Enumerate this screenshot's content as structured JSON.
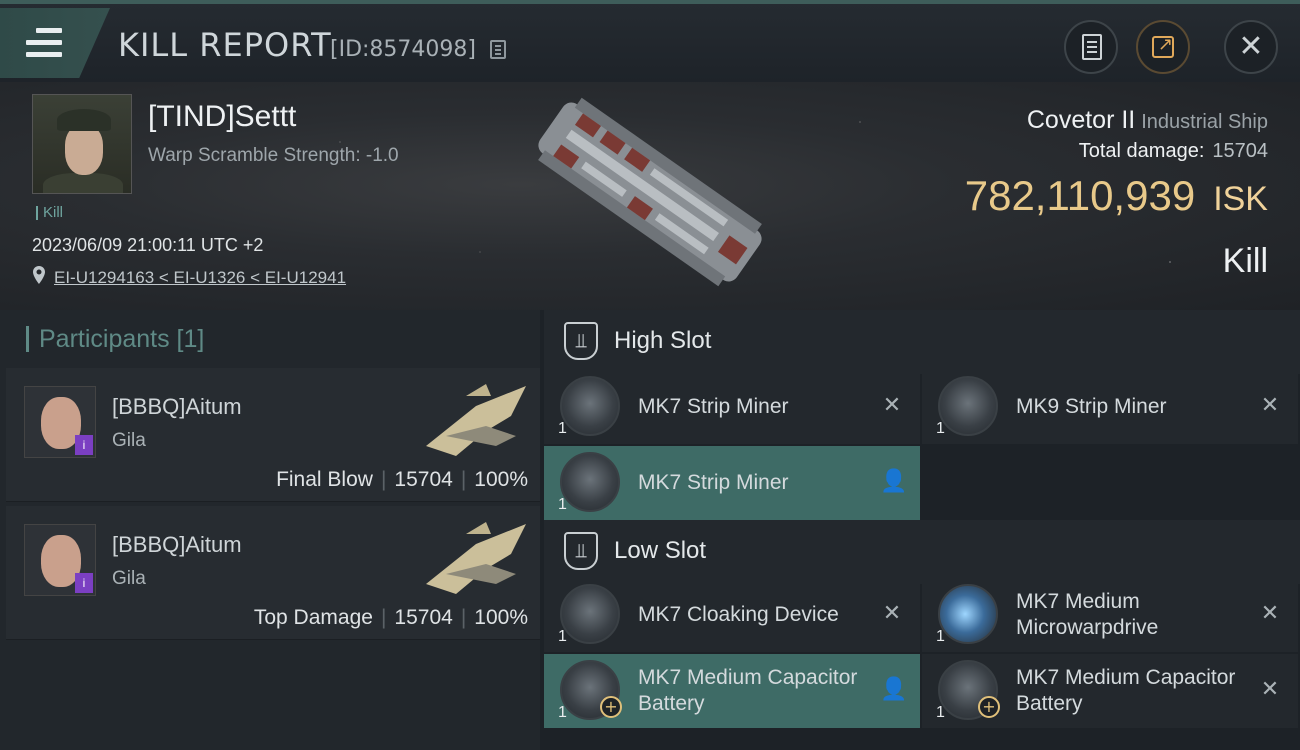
{
  "header": {
    "title": "KILL REPORT",
    "report_id": "[ID:8574098]"
  },
  "victim": {
    "name": "[TIND]Settt",
    "warp_scramble": "Warp Scramble Strength: -1.0",
    "tag": "Kill",
    "datetime": "2023/06/09 21:00:11 UTC +2",
    "location": "EI-U1294163 < EI-U1326 < EI-U12941"
  },
  "ship": {
    "name": "Covetor II",
    "class": "Industrial Ship",
    "total_damage_label": "Total damage:",
    "total_damage": "15704",
    "isk_value": "782,110,939",
    "isk_unit": "ISK",
    "result": "Kill"
  },
  "participants": {
    "title": "Participants [1]",
    "items": [
      {
        "name": "[BBBQ]Aitum",
        "ship": "Gila",
        "role": "Final Blow",
        "damage": "15704",
        "percent": "100%",
        "badge": "i"
      },
      {
        "name": "[BBBQ]Aitum",
        "ship": "Gila",
        "role": "Top Damage",
        "damage": "15704",
        "percent": "100%",
        "badge": "i"
      }
    ],
    "separator": "|"
  },
  "slots": {
    "high": {
      "title": "High Slot",
      "modules": [
        {
          "name": "MK7 Strip Miner",
          "qty": "1",
          "icon": "strip-miner-icon",
          "action": "✕"
        },
        {
          "name": "MK9 Strip Miner",
          "qty": "1",
          "icon": "strip-miner-icon",
          "action": "✕"
        },
        {
          "name": "MK7 Strip Miner",
          "qty": "1",
          "icon": "strip-miner-icon",
          "action": "👤"
        }
      ]
    },
    "low": {
      "title": "Low Slot",
      "modules": [
        {
          "name": "MK7 Cloaking Device",
          "qty": "1",
          "icon": "cloaking-device-icon",
          "action": "✕"
        },
        {
          "name": "MK7 Medium Microwarpdrive",
          "qty": "1",
          "icon": "microwarpdrive-icon",
          "action": "✕"
        },
        {
          "name": "MK7 Medium Capacitor Battery",
          "qty": "1",
          "icon": "capacitor-battery-icon",
          "action": "👤"
        },
        {
          "name": "MK7 Medium Capacitor Battery",
          "qty": "1",
          "icon": "capacitor-battery-icon",
          "action": "✕"
        }
      ]
    }
  },
  "colors": {
    "accent": "#3e6b66",
    "isk": "#e8c98a",
    "participants_title": "#5f8a86"
  }
}
